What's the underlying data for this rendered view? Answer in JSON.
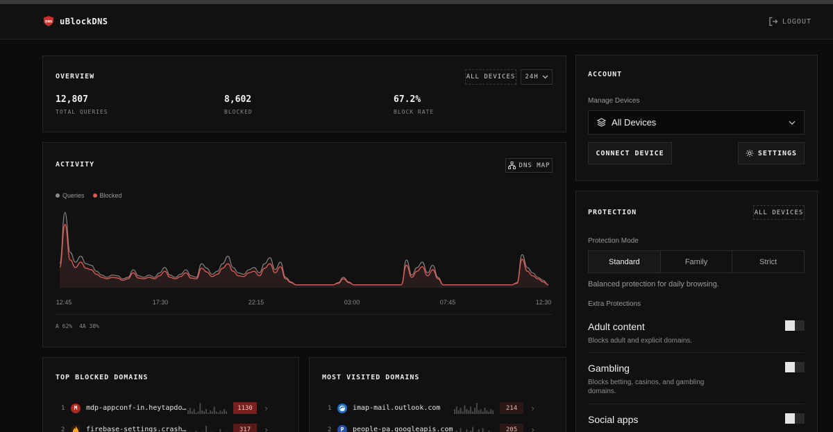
{
  "app": {
    "name": "uBlockDNS",
    "logout_label": "LOGOUT"
  },
  "overview": {
    "title": "OVERVIEW",
    "device_filter": "ALL DEVICES",
    "range": "24H",
    "stats": [
      {
        "value": "12,807",
        "label": "TOTAL QUERIES"
      },
      {
        "value": "8,602",
        "label": "BLOCKED"
      },
      {
        "value": "67.2%",
        "label": "BLOCK RATE"
      }
    ]
  },
  "activity": {
    "title": "ACTIVITY",
    "dns_map_label": "DNS MAP",
    "legend": [
      "Queries",
      "Blocked"
    ],
    "x_ticks": [
      "12:45",
      "17:30",
      "22:15",
      "03:00",
      "07:45",
      "12:30"
    ],
    "footer": [
      "A 62%",
      "4A 38%"
    ]
  },
  "chart_data": {
    "type": "area",
    "xlabel": "",
    "ylabel": "",
    "x_ticks": [
      "12:45",
      "17:30",
      "22:15",
      "03:00",
      "07:45",
      "12:30"
    ],
    "series": [
      {
        "name": "Queries",
        "values": [
          30,
          98,
          45,
          32,
          40,
          30,
          28,
          20,
          15,
          12,
          15,
          14,
          10,
          12,
          22,
          14,
          12,
          15,
          12,
          18,
          25,
          15,
          12,
          16,
          22,
          14,
          12,
          30,
          24,
          16,
          20,
          30,
          40,
          25,
          18,
          16,
          22,
          25,
          18,
          30,
          38,
          22,
          32,
          12,
          6,
          2,
          2,
          2,
          2,
          2,
          2,
          2,
          2,
          5,
          12,
          6,
          2,
          2,
          2,
          2,
          2,
          2,
          2,
          2,
          2,
          2,
          35,
          15,
          25,
          32,
          18,
          28,
          12,
          2,
          2,
          2,
          2,
          2,
          2,
          2,
          2,
          2,
          2,
          2,
          2,
          2,
          2,
          5,
          42,
          25,
          18,
          12,
          8,
          2
        ]
      },
      {
        "name": "Blocked",
        "values": [
          25,
          82,
          35,
          25,
          32,
          24,
          22,
          16,
          12,
          10,
          12,
          11,
          8,
          10,
          18,
          11,
          10,
          12,
          10,
          14,
          20,
          12,
          10,
          13,
          18,
          11,
          10,
          24,
          19,
          13,
          16,
          24,
          30,
          20,
          14,
          13,
          18,
          20,
          14,
          24,
          30,
          18,
          26,
          10,
          5,
          2,
          2,
          2,
          2,
          2,
          2,
          2,
          2,
          4,
          10,
          5,
          2,
          2,
          2,
          2,
          2,
          2,
          2,
          2,
          2,
          2,
          28,
          12,
          20,
          26,
          14,
          22,
          10,
          2,
          2,
          2,
          2,
          2,
          2,
          2,
          2,
          2,
          2,
          2,
          2,
          2,
          2,
          4,
          36,
          20,
          14,
          10,
          6,
          2
        ]
      }
    ],
    "colors": {
      "Queries": "#8a8a8a",
      "Blocked": "#e0574f"
    },
    "grid": false,
    "legend_position": "top-left"
  },
  "account": {
    "title": "ACCOUNT",
    "manage_label": "Manage Devices",
    "device_select": "All Devices",
    "connect_label": "CONNECT DEVICE",
    "settings_label": "SETTINGS"
  },
  "protection": {
    "title": "PROTECTION",
    "device_filter": "ALL DEVICES",
    "mode_label": "Protection Mode",
    "modes": [
      "Standard",
      "Family",
      "Strict"
    ],
    "active_mode": "Standard",
    "mode_desc": "Balanced protection for daily browsing.",
    "extra_label": "Extra Protections",
    "items": [
      {
        "title": "Adult content",
        "desc": "Blocks adult and explicit domains.",
        "enabled": false
      },
      {
        "title": "Gambling",
        "desc": "Blocks betting, casinos, and gambling domains.",
        "enabled": false
      },
      {
        "title": "Social apps",
        "desc": "",
        "enabled": false
      }
    ]
  },
  "top_blocked": {
    "title": "TOP BLOCKED DOMAINS",
    "rows": [
      {
        "rank": "1",
        "domain": "mdp-appconf-in.heytapdownload.com",
        "count": "1130",
        "icon": "M"
      },
      {
        "rank": "2",
        "domain": "firebase-settings.crashlytics.com",
        "count": "317",
        "icon": ""
      }
    ]
  },
  "most_visited": {
    "title": "MOST VISITED DOMAINS",
    "rows": [
      {
        "rank": "1",
        "domain": "imap-mail.outlook.com",
        "count": "214",
        "icon": ""
      },
      {
        "rank": "2",
        "domain": "people-pa.googleapis.com",
        "count": "205",
        "icon": "P"
      }
    ]
  },
  "colors": {
    "accent": "#e0574f",
    "blocked_badge": "#7a1f1f"
  }
}
